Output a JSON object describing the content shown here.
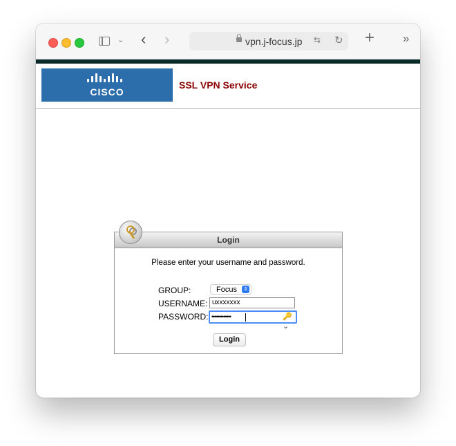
{
  "browser": {
    "url": "vpn.j-focus.jp",
    "icons": [
      "sidebar-icon",
      "chevron-down-icon",
      "back-icon",
      "forward-icon",
      "lock-icon",
      "translate-icon",
      "reload-icon",
      "plus-icon",
      "overflow-icon"
    ]
  },
  "header": {
    "logo_text": "CISCO",
    "service_title": "SSL VPN Service"
  },
  "login": {
    "title": "Login",
    "prompt": "Please enter your username and password.",
    "group_label": "GROUP:",
    "group_value": "Focus",
    "username_label": "USERNAME:",
    "username_value": "uxxxxxxx",
    "password_label": "PASSWORD:",
    "password_mask": "•••••••••••••",
    "button_label": "Login"
  },
  "colors": {
    "logo_bg": "#2c6eab",
    "service_title": "#8b0000",
    "top_band": "#0a2a2a",
    "focus_ring": "#4a8ef5"
  }
}
